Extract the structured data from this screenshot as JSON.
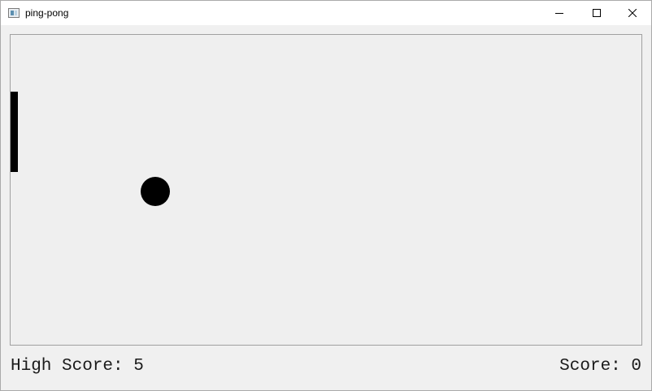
{
  "window": {
    "title": "ping-pong"
  },
  "controls": {
    "minimize_icon": "minimize-icon",
    "maximize_icon": "maximize-icon",
    "close_icon": "close-icon"
  },
  "scoreboard": {
    "high_score": "High Score: 5",
    "score": "Score: 0"
  },
  "colors": {
    "background": "#f0f0f0",
    "paddle": "#000000",
    "ball": "#000000"
  }
}
